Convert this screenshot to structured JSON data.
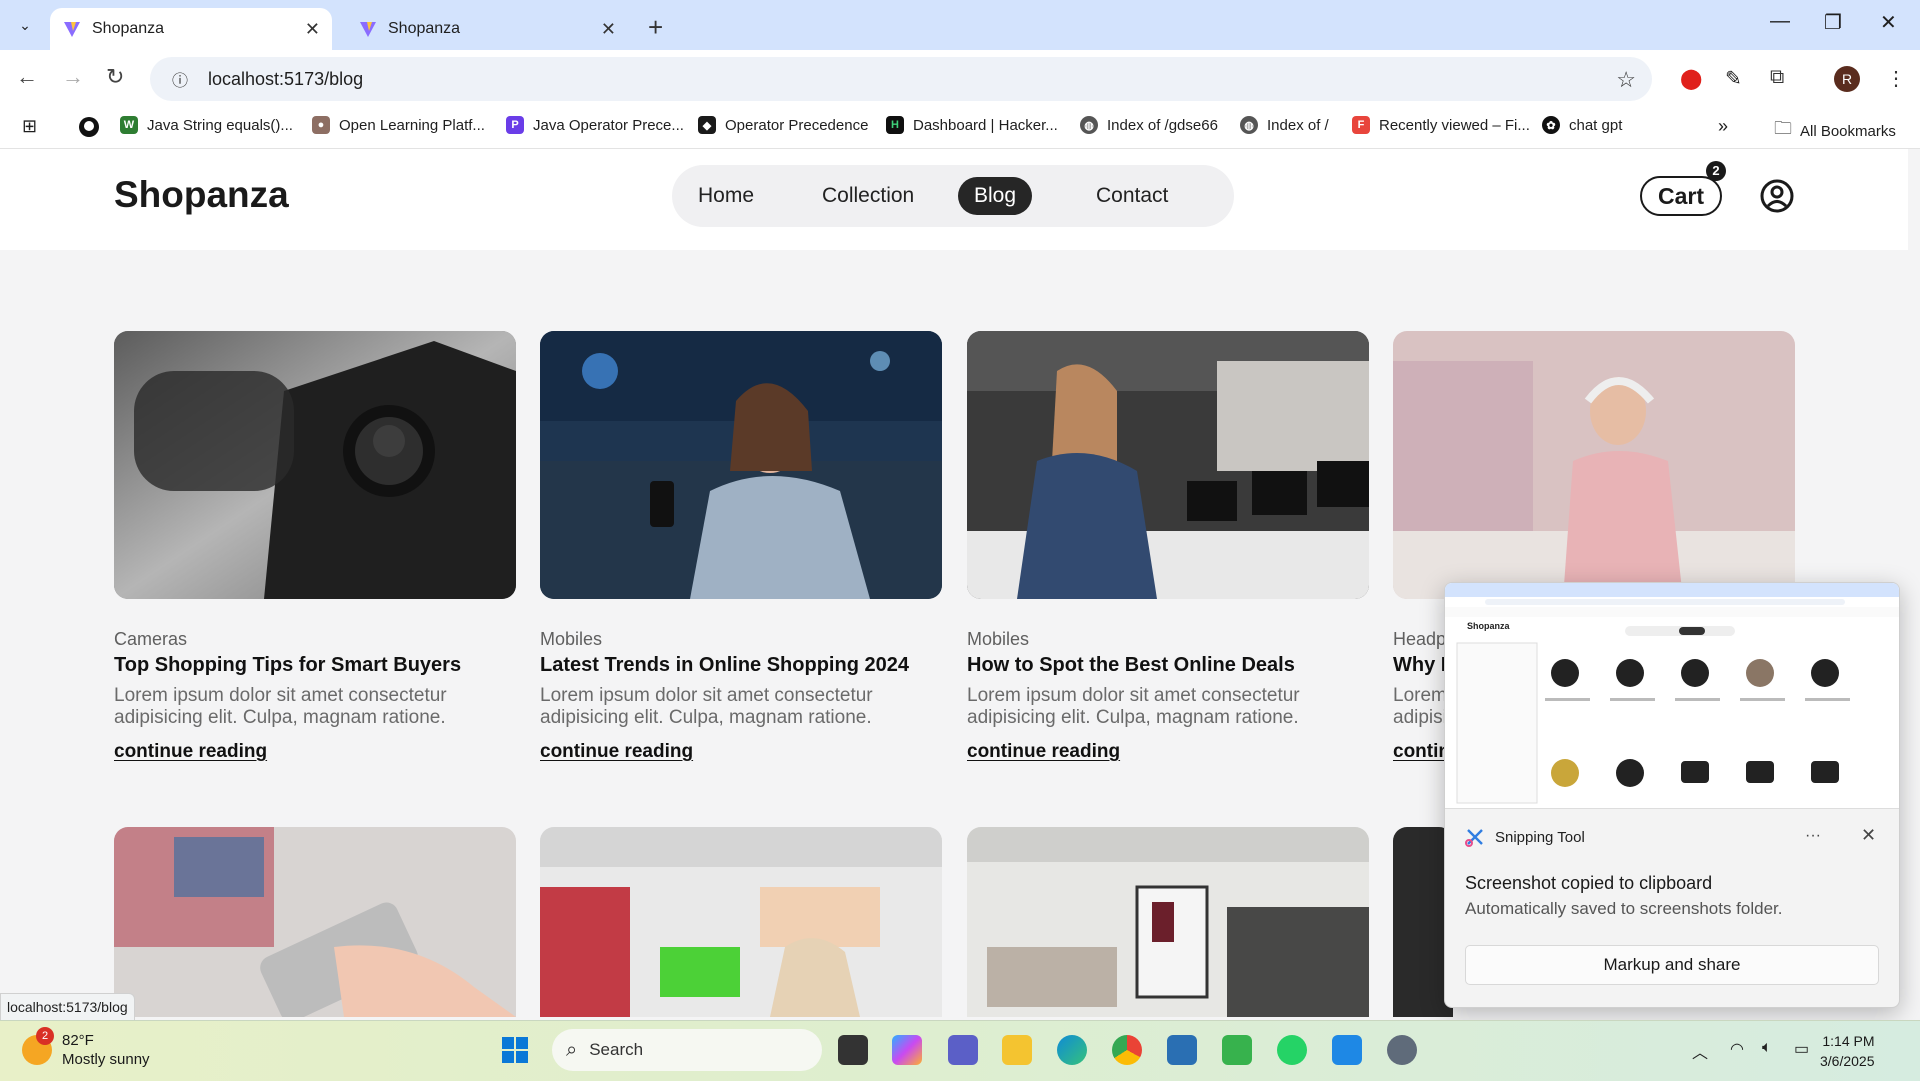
{
  "browser": {
    "tabs": [
      {
        "title": "Shopanza",
        "active": true
      },
      {
        "title": "Shopanza",
        "active": false
      }
    ],
    "url": "localhost:5173/blog",
    "profile_initial": "R",
    "bookmarks": [
      {
        "label": "Java String equals()...",
        "color": "#2e7d32"
      },
      {
        "label": "Open Learning Platf...",
        "color": "#8d6e63"
      },
      {
        "label": "Java Operator Prece...",
        "color": "#6a3de8"
      },
      {
        "label": "Operator Precedence",
        "color": "#1a1a1a"
      },
      {
        "label": "Dashboard | Hacker...",
        "color": "#0f0f0f"
      },
      {
        "label": "Index of /gdse66",
        "color": "#555555"
      },
      {
        "label": "Index of /",
        "color": "#555555"
      },
      {
        "label": "Recently viewed – Fi...",
        "color": "#e8453c"
      },
      {
        "label": "chat gpt",
        "color": "#111111"
      }
    ],
    "all_bookmarks": "All Bookmarks",
    "status_url": "localhost:5173/blog"
  },
  "site": {
    "logo": "Shopanza",
    "nav": [
      {
        "label": "Home",
        "active": false
      },
      {
        "label": "Collection",
        "active": false
      },
      {
        "label": "Blog",
        "active": true
      },
      {
        "label": "Contact",
        "active": false
      }
    ],
    "cart_label": "Cart",
    "cart_count": "2"
  },
  "posts": [
    {
      "category": "Cameras",
      "title": "Top Shopping Tips for Smart Buyers",
      "excerpt_line1": "Lorem ipsum dolor sit amet consectetur",
      "excerpt_line2": "adipisicing elit. Culpa, magnam ratione.",
      "link": "continue reading"
    },
    {
      "category": "Mobiles",
      "title": "Latest Trends in Online Shopping 2024",
      "excerpt_line1": "Lorem ipsum dolor sit amet consectetur",
      "excerpt_line2": "adipisicing elit. Culpa, magnam ratione.",
      "link": "continue reading"
    },
    {
      "category": "Mobiles",
      "title": "How to Spot the Best Online Deals",
      "excerpt_line1": "Lorem ipsum dolor sit amet consectetur",
      "excerpt_line2": "adipisicing elit. Culpa, magnam ratione.",
      "link": "continue reading"
    },
    {
      "category": "Headp",
      "title": "Why E",
      "excerpt_line1": "Lorem",
      "excerpt_line2": "adipisi",
      "link": "contin"
    }
  ],
  "snipping_tool": {
    "app_name": "Snipping Tool",
    "message": "Screenshot copied to clipboard",
    "sub_message": "Automatically saved to screenshots folder.",
    "button": "Markup and share",
    "preview_logo": "Shopanza"
  },
  "taskbar": {
    "temperature": "82°F",
    "condition": "Mostly sunny",
    "weather_badge": "2",
    "search_placeholder": "Search",
    "time": "1:14 PM",
    "date": "3/6/2025"
  }
}
